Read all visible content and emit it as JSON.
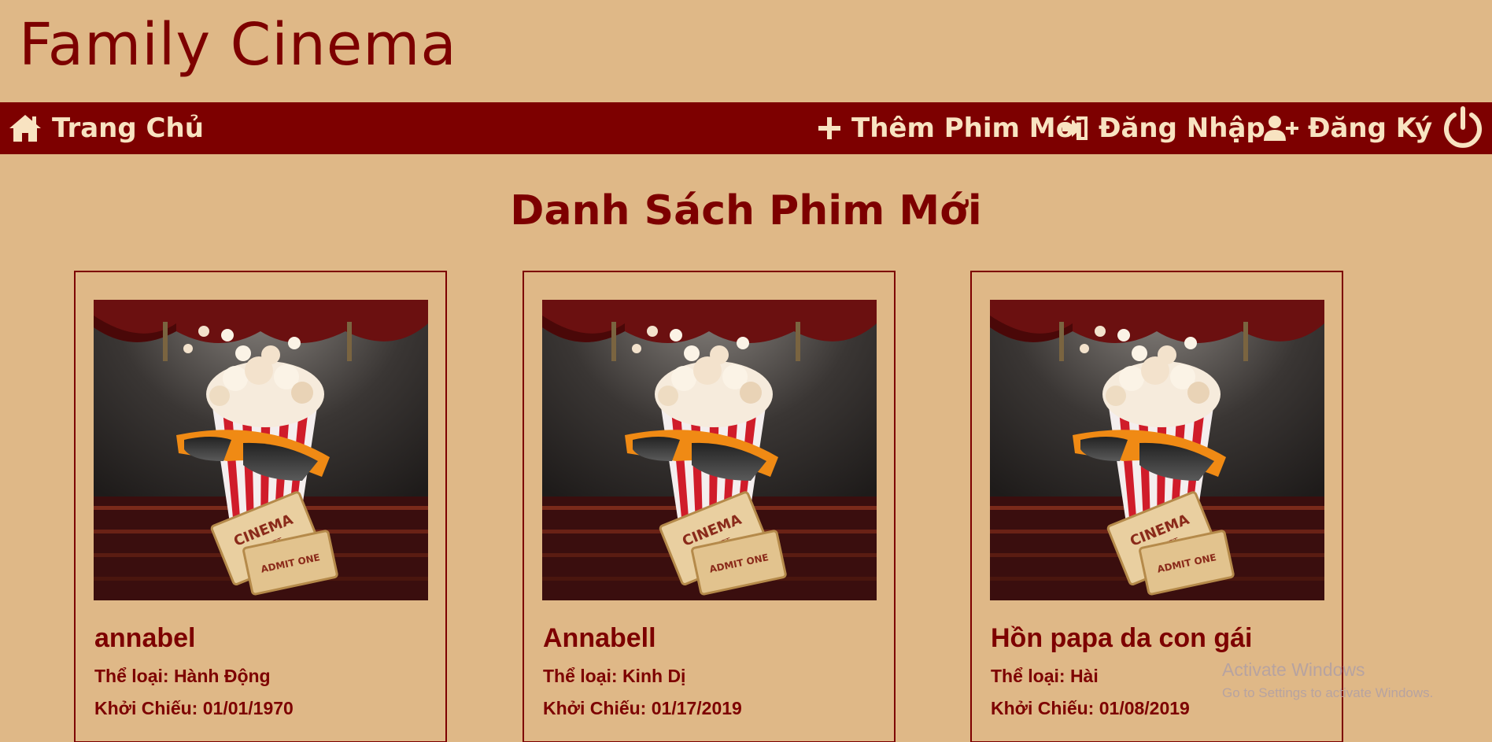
{
  "site": {
    "title": "Family Cinema"
  },
  "nav": {
    "home": {
      "label": "Trang Chủ",
      "icon": "home-icon"
    },
    "add_movie": {
      "label": "Thêm Phim Mới",
      "icon": "plus-icon"
    },
    "login": {
      "label": "Đăng Nhập",
      "icon": "sign-in-icon"
    },
    "register": {
      "label": "Đăng Ký",
      "icon": "user-plus-icon"
    },
    "logout": {
      "icon": "power-icon"
    }
  },
  "page": {
    "heading": "Danh Sách Phim Mới"
  },
  "movies": [
    {
      "title": "annabel",
      "genre": "Thể loại: Hành Động",
      "release": "Khởi Chiếu: 01/01/1970"
    },
    {
      "title": "Annabell",
      "genre": "Thể loại: Kinh Dị",
      "release": "Khởi Chiếu: 01/17/2019"
    },
    {
      "title": "Hồn papa da con gái",
      "genre": "Thể loại: Hài",
      "release": "Khởi Chiếu: 01/08/2019"
    }
  ],
  "poster": {
    "ticket_text": "CINEMA",
    "ticket_sub": "TICKET",
    "ticket_admit": "ADMIT ONE"
  },
  "watermark": {
    "title": "Activate Windows",
    "subtitle": "Go to Settings to activate Windows."
  },
  "colors": {
    "background": "#dfb887",
    "brand": "#7d0000",
    "nav_text": "#f8e3c1"
  }
}
